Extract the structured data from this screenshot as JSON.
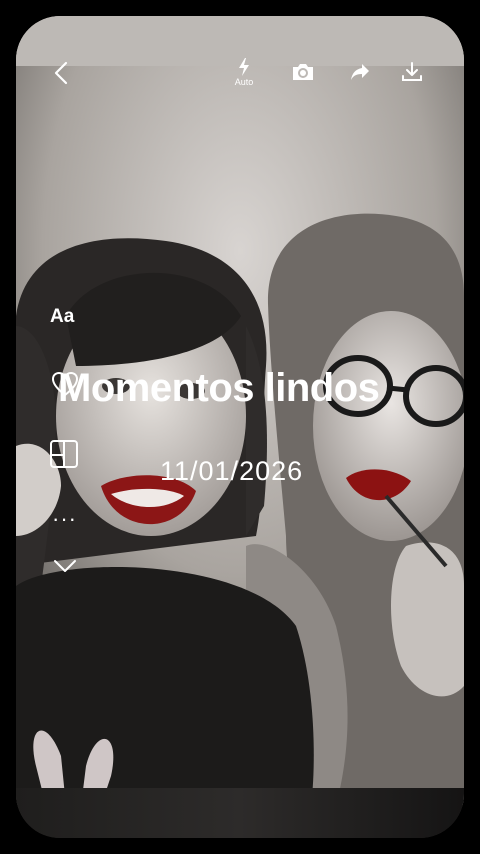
{
  "toolbar": {
    "back_icon": "chevron-left-icon",
    "flash_icon": "flash-icon",
    "flash_mode": "Auto",
    "camera_icon": "camera-icon",
    "share_icon": "share-icon",
    "download_icon": "download-icon"
  },
  "side_tools": {
    "text_tool_label": "Aa",
    "favorite_icon": "heart-icon",
    "layout_icon": "layout-icon",
    "more_label": "···",
    "collapse_icon": "chevron-down-icon"
  },
  "overlay": {
    "title": "Momentos lindos",
    "date": "11/01/2026"
  }
}
